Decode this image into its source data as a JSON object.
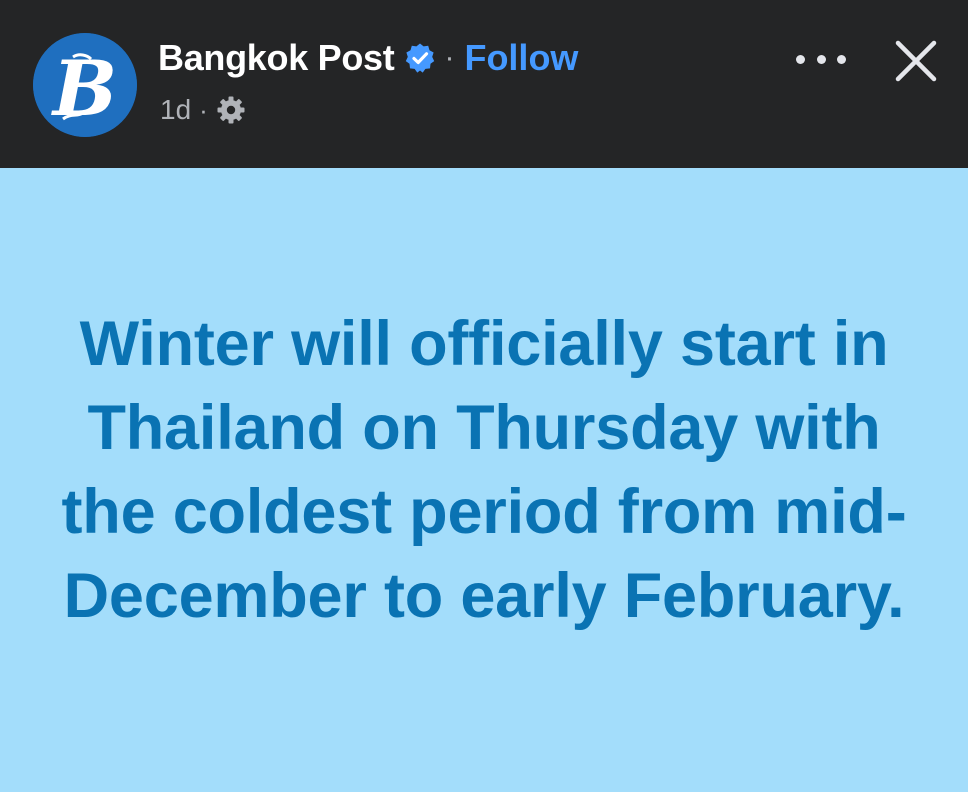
{
  "header": {
    "page_name": "Bangkok Post",
    "separator": "·",
    "follow_label": "Follow",
    "time": "1d",
    "meta_separator": "·",
    "icons": {
      "avatar": "bangkok-post-logo",
      "verified": "verified-badge-icon",
      "audience": "gear-icon",
      "more": "more-options-icon",
      "close": "close-icon"
    },
    "colors": {
      "background": "#242526",
      "follow": "#4599ff",
      "verified": "#4599ff",
      "avatar": "#1f6fbf"
    }
  },
  "post": {
    "text": "Winter will officially start in Thailand on Thursday with the coldest period from mid-December to early February.",
    "colors": {
      "background": "#a3ddfb",
      "text": "#0a73b3"
    }
  }
}
